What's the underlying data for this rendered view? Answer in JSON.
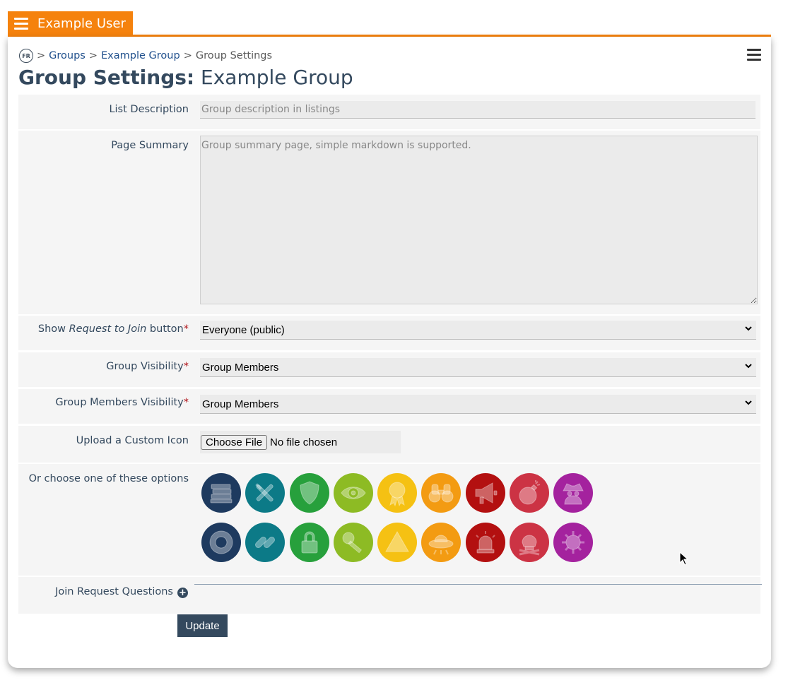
{
  "header": {
    "user_name": "Example User"
  },
  "breadcrumb": {
    "home_glyph": "FR",
    "sep": ">",
    "groups": "Groups",
    "group": "Example Group",
    "current": "Group Settings"
  },
  "title": {
    "prefix": "Group Settings:",
    "group": "Example Group"
  },
  "form": {
    "list_description": {
      "label": "List Description",
      "placeholder": "Group description in listings"
    },
    "page_summary": {
      "label": "Page Summary",
      "placeholder": "Group summary page, simple markdown is supported."
    },
    "request_to_join": {
      "label_pre": "Show ",
      "label_em": "Request to Join",
      "label_post": " button",
      "required": "*",
      "value": "Everyone (public)"
    },
    "group_visibility": {
      "label": "Group Visibility",
      "required": "*",
      "value": "Group Members"
    },
    "members_visibility": {
      "label": "Group Members Visibility",
      "required": "*",
      "value": "Group Members"
    },
    "custom_icon": {
      "label": "Upload a Custom Icon",
      "button": "Choose File",
      "status": "No file chosen"
    },
    "icon_options": {
      "label": "Or choose one of these options",
      "icons": [
        {
          "name": "books-icon",
          "color": "#1e3a5f"
        },
        {
          "name": "tools-icon",
          "color": "#0c7a87"
        },
        {
          "name": "shield-icon",
          "color": "#27a03c"
        },
        {
          "name": "eye-icon",
          "color": "#8dbb24"
        },
        {
          "name": "award-icon",
          "color": "#f5c113"
        },
        {
          "name": "binoculars-icon",
          "color": "#f39b12"
        },
        {
          "name": "megaphone-icon",
          "color": "#b31010"
        },
        {
          "name": "bomb-icon",
          "color": "#cc3344"
        },
        {
          "name": "spy-icon",
          "color": "#a4229e"
        },
        {
          "name": "life-ring-icon",
          "color": "#1e3a5f"
        },
        {
          "name": "link-icon",
          "color": "#0c7a87"
        },
        {
          "name": "lock-icon",
          "color": "#27a03c"
        },
        {
          "name": "key-icon",
          "color": "#8dbb24"
        },
        {
          "name": "warning-icon",
          "color": "#f5c113"
        },
        {
          "name": "ufo-icon",
          "color": "#f39b12"
        },
        {
          "name": "siren-icon",
          "color": "#b31010"
        },
        {
          "name": "skull-icon",
          "color": "#cc3344"
        },
        {
          "name": "virus-icon",
          "color": "#a4229e"
        }
      ]
    },
    "join_questions": {
      "label": "Join Request Questions",
      "add_glyph": "+"
    },
    "update_button": "Update"
  },
  "colors": {
    "brand_orange": "#f5820d",
    "primary_dark": "#34495e",
    "link": "#1f4f8c",
    "required": "#b0161c"
  }
}
